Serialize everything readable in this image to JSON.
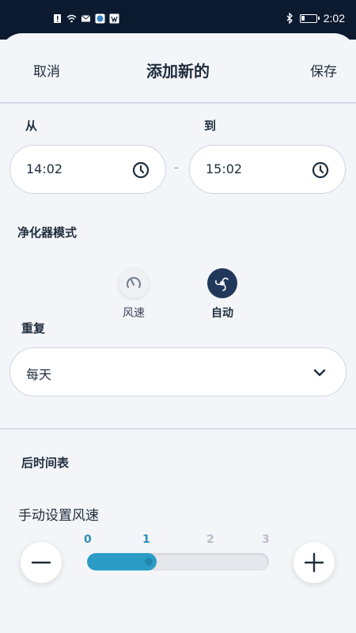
{
  "status_bar": {
    "time": "2:02",
    "battery_level": 0.2
  },
  "header": {
    "cancel_label": "取消",
    "title": "添加新的",
    "save_label": "保存"
  },
  "time_range": {
    "from_label": "从",
    "to_label": "到",
    "from_value": "14:02",
    "to_value": "15:02",
    "separator": "-"
  },
  "purifier_mode": {
    "label": "净化器模式",
    "options": [
      {
        "label": "风速",
        "icon": "speedometer-icon",
        "selected": false
      },
      {
        "label": "自动",
        "icon": "fan-icon",
        "selected": true
      }
    ]
  },
  "repeat": {
    "label": "重复",
    "value": "每天"
  },
  "after_schedule": {
    "label": "后时间表"
  },
  "fan_speed": {
    "label": "手动设置风速",
    "ticks": [
      "0",
      "1",
      "2",
      "3"
    ],
    "min": 0,
    "max": 3,
    "value": 1
  },
  "colors": {
    "accent": "#2b9cc6",
    "dark_navy": "#22385a",
    "status_bar": "#0c1a30",
    "background": "#f4f5f9"
  }
}
